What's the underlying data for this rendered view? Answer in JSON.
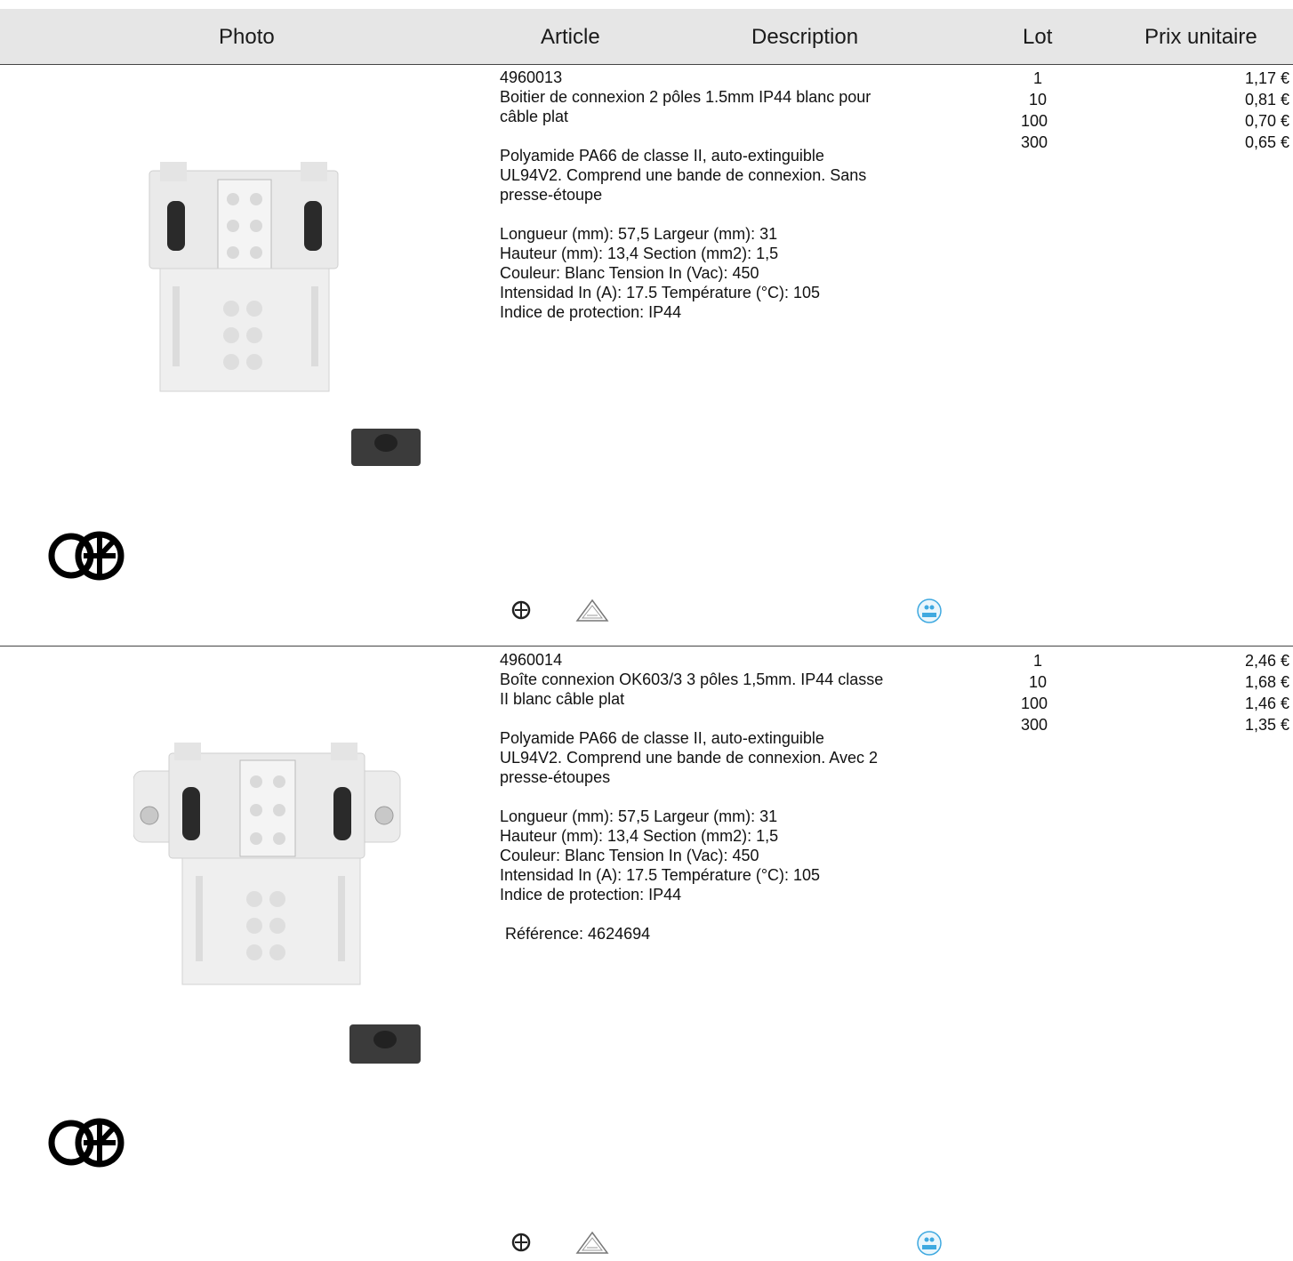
{
  "header": {
    "photo": "Photo",
    "article": "Article",
    "description": "Description",
    "lot": "Lot",
    "price": "Prix unitaire"
  },
  "products": [
    {
      "code": "4960013",
      "title": "Boitier de connexion 2 pôles 1.5mm IP44 blanc pour\ncâble plat",
      "material": "Polyamide PA66 de classe II, auto-extinguible\nUL94V2. Comprend une bande de connexion. Sans\npresse-étoupe",
      "specs": "Longueur (mm): 57,5 Largeur (mm): 31\nHauteur (mm): 13,4 Section (mm2): 1,5\nCouleur: Blanc Tension In (Vac): 450\nIntensidad In (A): 17.5 Température (°C): 105\nIndice de protection: IP44",
      "lots": [
        "1",
        "10",
        "100",
        "300"
      ],
      "prices": [
        "1,17 €",
        "0,81 €",
        "0,70 €",
        "0,65 €"
      ]
    },
    {
      "code": "4960014",
      "title": "Boîte connexion OK603/3 3 pôles 1,5mm. IP44 classe\nII blanc câble plat",
      "material": "Polyamide PA66 de classe II, auto-extinguible\nUL94V2. Comprend une bande de connexion. Avec 2\npresse-étoupes",
      "specs": "Longueur (mm): 57,5 Largeur (mm): 31\nHauteur (mm): 13,4 Section (mm2): 1,5\nCouleur: Blanc Tension In (Vac): 450\nIntensidad In (A): 17.5 Température (°C): 105\nIndice de protection: IP44",
      "reference": "Référence: 4624694",
      "lots": [
        "1",
        "10",
        "100",
        "300"
      ],
      "prices": [
        "2,46 €",
        "1,68 €",
        "1,46 €",
        "1,35 €"
      ]
    }
  ],
  "icons": [
    "ok-brand-logo",
    "ground-symbol-icon",
    "class-ii-cert-icon",
    "ip44-badge-icon",
    "product-photo"
  ],
  "colors": {
    "header_bg": "#e6e6e6",
    "ip44_badge": "#3fa9e0"
  }
}
